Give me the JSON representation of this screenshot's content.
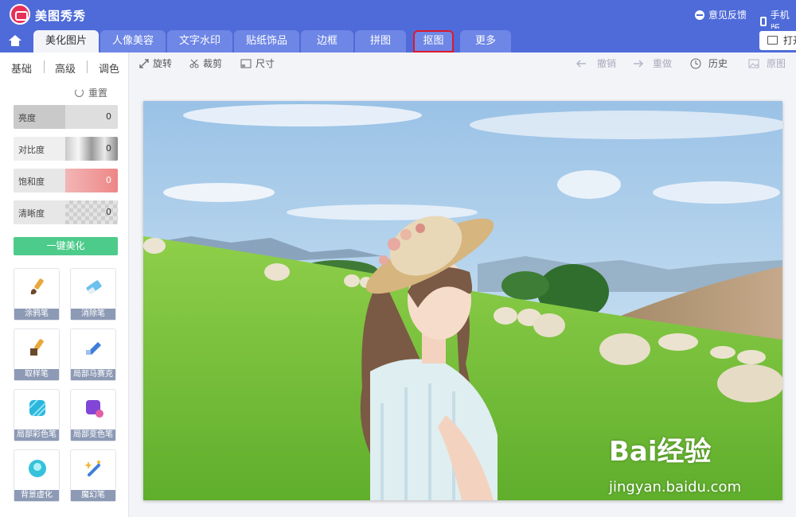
{
  "app": {
    "title": "美图秀秀"
  },
  "titlebar": {
    "feedback_label": "意见反馈",
    "mobile_label": "手机版"
  },
  "tabs": [
    {
      "label": "美化图片",
      "active": true
    },
    {
      "label": "人像美容"
    },
    {
      "label": "文字水印"
    },
    {
      "label": "贴纸饰品"
    },
    {
      "label": "边框"
    },
    {
      "label": "拼图"
    },
    {
      "label": "抠图",
      "highlighted": true
    },
    {
      "label": "更多"
    }
  ],
  "open_button": {
    "label": "打开"
  },
  "subtabs": [
    "基础",
    "高级",
    "调色"
  ],
  "reset_label": "重置",
  "sliders": [
    {
      "label": "亮度",
      "value": "0"
    },
    {
      "label": "对比度",
      "value": "0"
    },
    {
      "label": "饱和度",
      "value": "0"
    },
    {
      "label": "清晰度",
      "value": "0"
    }
  ],
  "oneclick_label": "一键美化",
  "tools": [
    {
      "label": "涂鸦笔",
      "icon": "brush-icon"
    },
    {
      "label": "消除笔",
      "icon": "eraser-icon"
    },
    {
      "label": "取样笔",
      "icon": "sample-brush-icon"
    },
    {
      "label": "局部马赛克",
      "icon": "mosaic-pen-icon"
    },
    {
      "label": "局部彩色笔",
      "icon": "color-pen-icon"
    },
    {
      "label": "局部变色笔",
      "icon": "recolor-pen-icon"
    },
    {
      "label": "背景虚化",
      "icon": "blur-background-icon"
    },
    {
      "label": "魔幻笔",
      "icon": "magic-pen-icon"
    }
  ],
  "toolbar": {
    "rotate": "旋转",
    "crop": "裁剪",
    "size": "尺寸",
    "undo": "撤销",
    "redo": "重做",
    "history": "历史",
    "original": "原图"
  },
  "watermark": {
    "brand": "Bai经验",
    "url": "jingyan.baidu.com"
  },
  "colors": {
    "accent": "#4f6bd9",
    "tab_inactive": "#6e86e6",
    "green_button": "#4dcb8b",
    "highlight_border": "#e0182a"
  }
}
